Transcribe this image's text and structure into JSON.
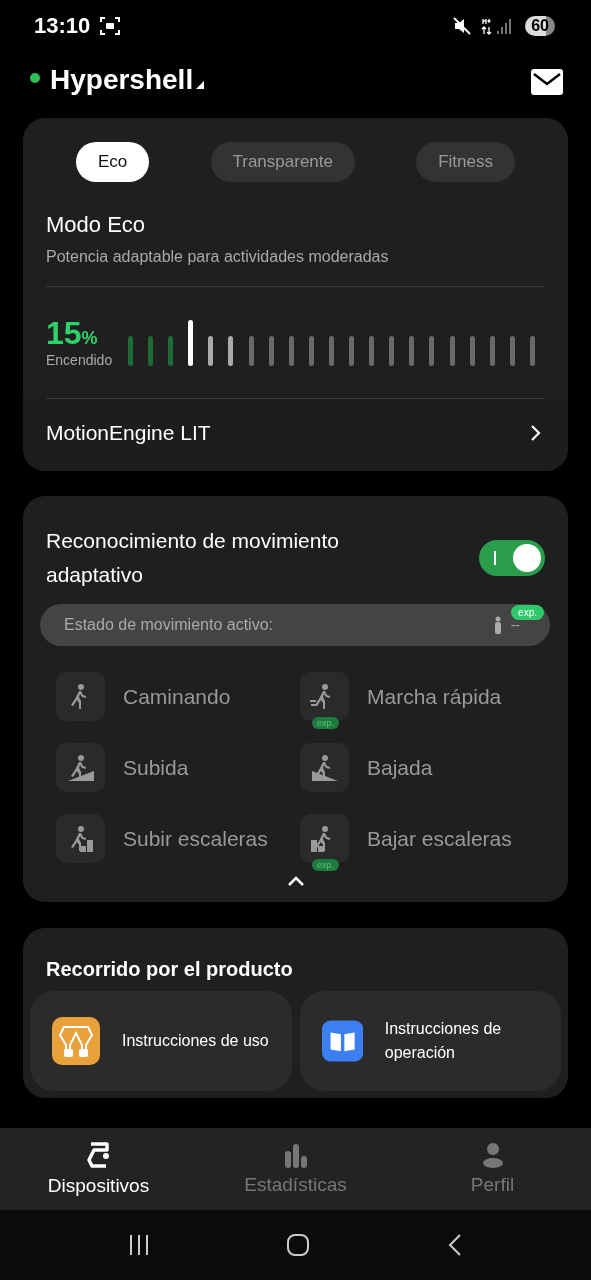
{
  "status_bar": {
    "time": "13:10",
    "battery": "60"
  },
  "header": {
    "title": "Hypershell",
    "connected": true
  },
  "mode_card": {
    "tabs": [
      {
        "label": "Eco",
        "selected": true
      },
      {
        "label": "Transparente",
        "selected": false
      },
      {
        "label": "Fitness",
        "selected": false
      }
    ],
    "mode_title": "Modo Eco",
    "mode_description": "Potencia adaptable para actividades moderadas",
    "power": {
      "value": "15",
      "unit": "%",
      "caption": "Encendido",
      "level": 0.15
    },
    "engine_link": "MotionEngine LIT"
  },
  "motion_card": {
    "title": "Reconocimiento de movimiento adaptativo",
    "on": true,
    "status_label": "Estado de movimiento activo:",
    "status_value": "--",
    "status_badge": "exp.",
    "activities": [
      {
        "kind": "walk",
        "label": "Caminando"
      },
      {
        "kind": "fastwalk",
        "label": "Marcha rápida",
        "badge": "exp."
      },
      {
        "kind": "uphill",
        "label": "Subida"
      },
      {
        "kind": "downhill",
        "label": "Bajada"
      },
      {
        "kind": "stairsup",
        "label": "Subir escaleras"
      },
      {
        "kind": "stairsdown",
        "label": "Bajar escaleras",
        "badge": "exp."
      }
    ],
    "expanded": true
  },
  "tour_card": {
    "title": "Recorrido por el producto",
    "items": [
      {
        "kind": "device",
        "label": "Instrucciones de uso"
      },
      {
        "kind": "book",
        "label": "Instrucciones de operación"
      }
    ]
  },
  "bottom_nav": [
    {
      "kind": "devices",
      "label": "Dispositivos",
      "selected": true
    },
    {
      "kind": "stats",
      "label": "Estadísticas",
      "selected": false
    },
    {
      "kind": "profile",
      "label": "Perfil",
      "selected": false
    }
  ]
}
